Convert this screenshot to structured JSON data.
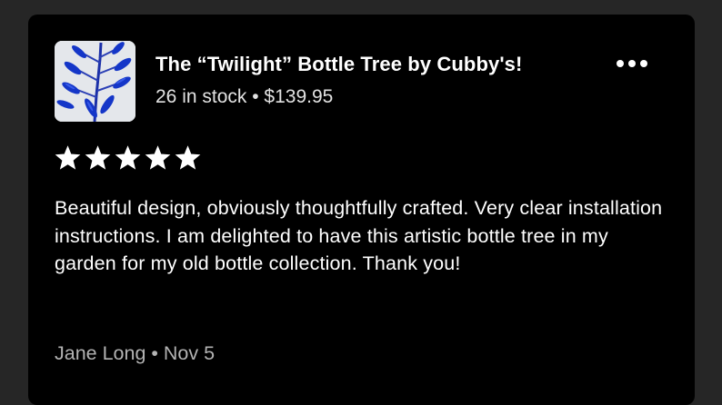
{
  "listing": {
    "title": "The “Twilight” Bottle Tree by Cubby's!",
    "meta": "26 in stock • $139.95",
    "thumbnail_icon": "blue-bottle-tree-thumbnail"
  },
  "menu": {
    "icon": "more-options-icon"
  },
  "rating": {
    "value": 5,
    "max": 5,
    "star_color": "#ffffff"
  },
  "review": {
    "text": "Beautiful design, obviously thoughtfully crafted. Very clear installation instructions. I am delighted to have this artistic bottle tree in my garden for my old bottle collection. Thank you!",
    "byline": "Jane Long • Nov 5"
  },
  "colors": {
    "page_background": "#262626",
    "card_background": "#000000",
    "bottle_blue": "#1436c8"
  }
}
